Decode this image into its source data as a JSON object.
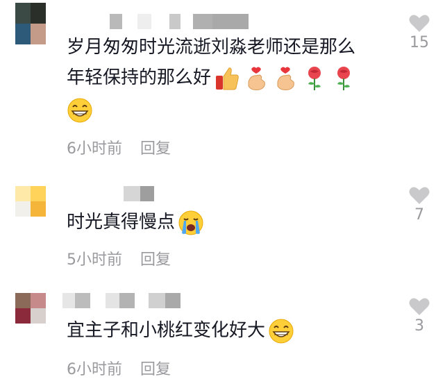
{
  "comments": [
    {
      "text_line1": "岁月匆匆时光流逝刘淼老师还是那么",
      "text_line2": "年轻保持的那么好",
      "emojis_line2": [
        "thumbs-up-icon",
        "finger-heart-icon",
        "finger-heart-icon",
        "rose-icon",
        "rose-icon"
      ],
      "emojis_line3": [
        "grin-icon"
      ],
      "time": "6小时前",
      "reply": "回复",
      "likes": "15"
    },
    {
      "text_line1": "时光真得慢点",
      "emojis_line1": [
        "crying-icon"
      ],
      "time": "5小时前",
      "reply": "回复",
      "likes": "7"
    },
    {
      "text_line1": "宜主子和小桃红变化好大",
      "emojis_line1": [
        "grin-icon"
      ],
      "time": "6小时前",
      "reply": "回复",
      "likes": "3"
    }
  ],
  "colors": {
    "text": "#161823",
    "muted": "#9a9a9e",
    "heart": "#c9c9cc"
  }
}
